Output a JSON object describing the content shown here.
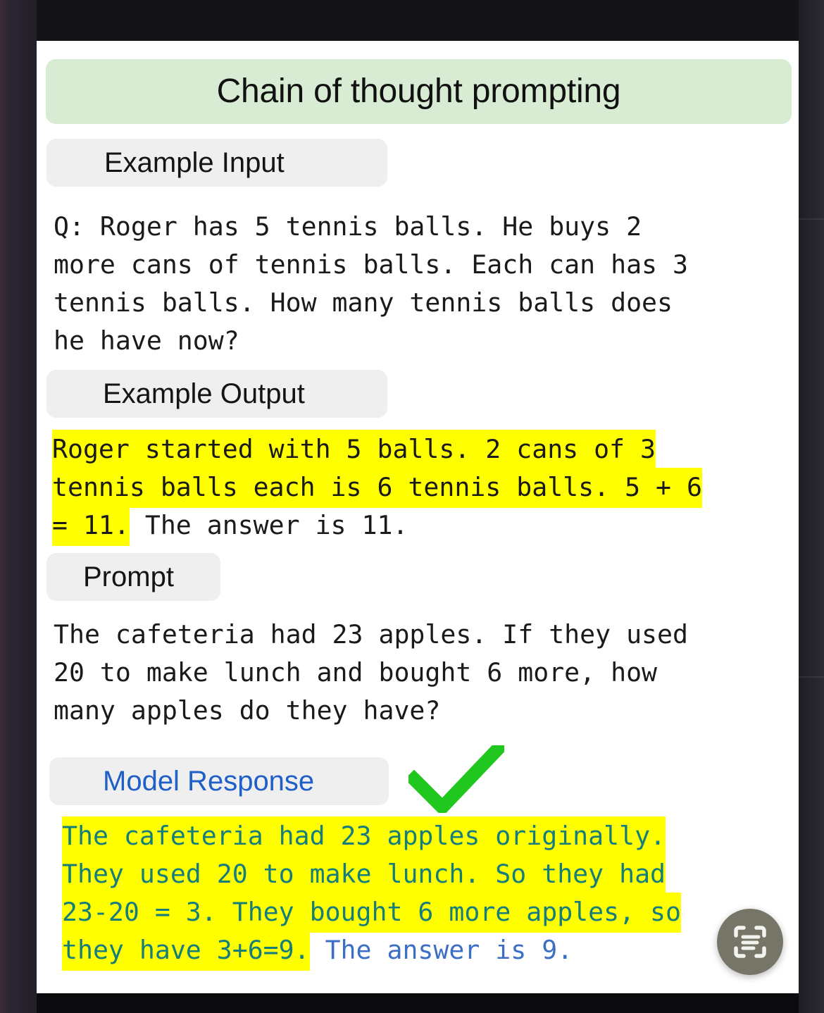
{
  "header": {
    "title": "Chain of thought prompting",
    "banner_color": "#d8ecd3"
  },
  "sections": {
    "example_input": {
      "label": "Example Input",
      "body": "Q: Roger has 5 tennis balls. He buys 2\nmore cans of tennis balls. Each can has 3\ntennis balls. How many tennis balls does\nhe have now?"
    },
    "example_output": {
      "label": "Example Output",
      "highlighted_1": "Roger started with 5 balls. 2 cans of 3",
      "highlighted_2": "tennis balls each is 6 tennis balls. 5 + 6",
      "highlighted_3": "= 11.",
      "plain_3": " The answer is 11."
    },
    "prompt": {
      "label": "Prompt",
      "body": "The cafeteria had 23 apples. If they used\n20 to make lunch and bought 6 more, how\nmany apples do they have?"
    },
    "model_response": {
      "label": "Model Response",
      "label_color": "#1f5fc8",
      "text_color": "#3b6fc6",
      "status_icon": "check-mark-icon",
      "status_icon_color": "#1fc71f",
      "highlighted_1": "The cafeteria had 23 apples originally.",
      "highlighted_2": "They used 20 to make lunch. So they had",
      "highlighted_3": "23-20 = 3. They bought 6 more apples, so",
      "highlighted_4": "they have 3+6=9.",
      "plain_4": " The answer is 9."
    }
  },
  "floating_button": {
    "icon": "scan-text-icon",
    "color": "#767568"
  },
  "highlight_color": "#ffff00"
}
